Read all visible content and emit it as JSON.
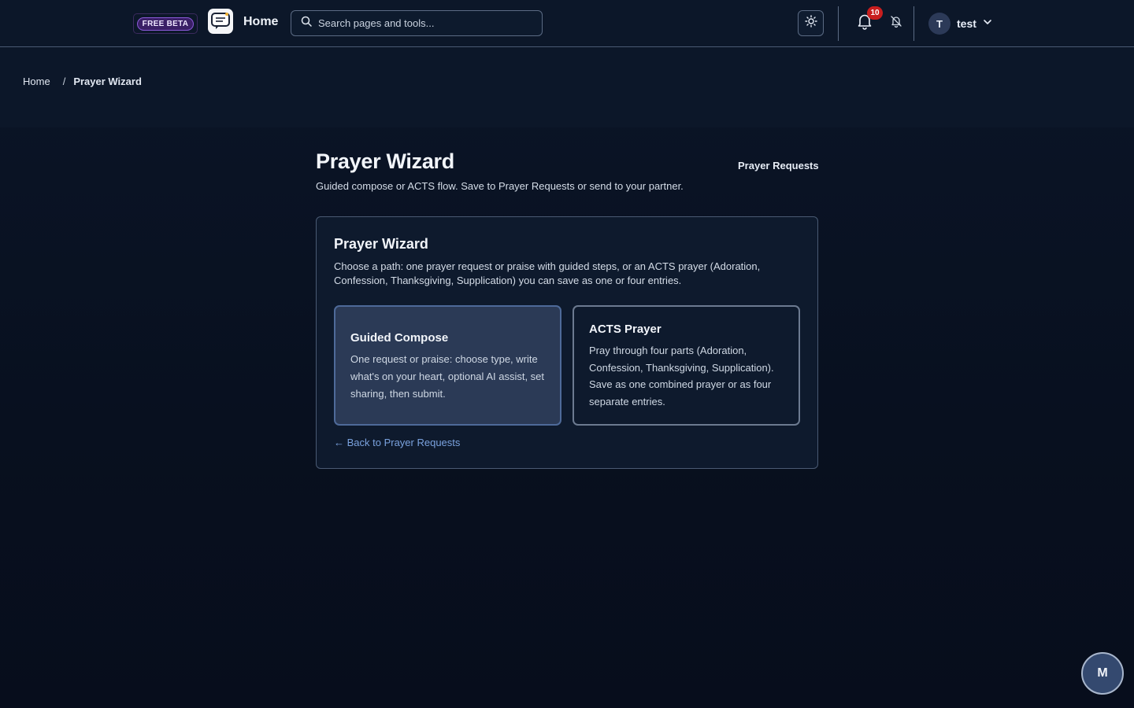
{
  "topbar": {
    "beta_label": "FREE BETA",
    "home_label": "Home",
    "search_placeholder": "Search pages and tools...",
    "notification_count": "10",
    "user_initial": "T",
    "user_name": "test"
  },
  "breadcrumb": {
    "home": "Home",
    "separator": "/",
    "current": "Prayer Wizard"
  },
  "page": {
    "title": "Prayer Wizard",
    "subtitle": "Guided compose or ACTS flow. Save to Prayer Requests or send to your partner.",
    "header_link": "Prayer Requests"
  },
  "card": {
    "title": "Prayer Wizard",
    "description": "Choose a path: one prayer request or praise with guided steps, or an ACTS prayer (Adoration, Confession, Thanksgiving, Supplication) you can save as one or four entries.",
    "options": [
      {
        "title": "Guided Compose",
        "description": "One request or praise: choose type, write what's on your heart, optional AI assist, set sharing, then submit."
      },
      {
        "title": "ACTS Prayer",
        "description": "Pray through four parts (Adoration, Confession, Thanksgiving, Supplication). Save as one combined prayer or as four separate entries."
      }
    ],
    "back_link": "← Back to Prayer Requests"
  },
  "fab": {
    "label": "M"
  },
  "icons": {
    "search": "search-icon",
    "theme": "sun-icon",
    "bell": "bell-icon",
    "bell_off": "bell-off-icon",
    "chevron": "chevron-down-icon",
    "logo": "chat-logo-icon"
  },
  "colors": {
    "background": "#08101f",
    "accent_link": "#7aa2de",
    "badge": "#c81e1e",
    "beta": "#3a1f66"
  }
}
